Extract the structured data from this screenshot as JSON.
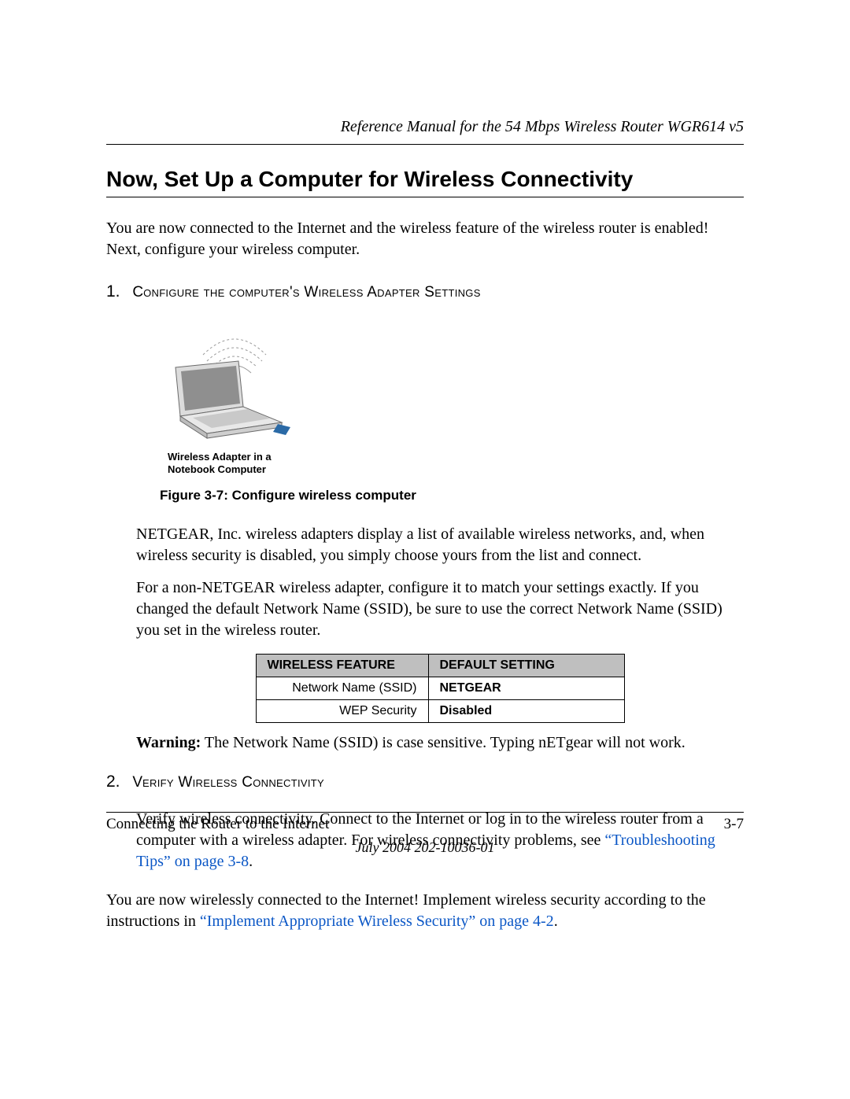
{
  "running_head": "Reference Manual for the 54 Mbps Wireless Router WGR614 v5",
  "section_title": "Now, Set Up a Computer for Wireless Connectivity",
  "intro": "You are now connected to the Internet and the wireless feature of the wireless router is enabled! Next, configure your wireless computer.",
  "step1": {
    "num": "1.",
    "pre": "C",
    "rest": "onfigure the computer's Wireless Adapter Settings"
  },
  "figure": {
    "caption_small_l1": "Wireless Adapter in a",
    "caption_small_l2": "Notebook Computer",
    "caption": "Figure 3-7:  Configure wireless computer"
  },
  "para1": "NETGEAR, Inc. wireless adapters display a list of available wireless networks, and, when wireless security is disabled, you simply choose yours from the list and connect.",
  "para2": "For a non-NETGEAR wireless adapter, configure it to match your settings exactly. If you changed the default Network Name (SSID), be sure to use the correct Network Name (SSID) you set in the wireless router.",
  "table": {
    "h1": "Wireless Feature",
    "h2": "Default Setting",
    "r1c1": "Network Name (SSID)",
    "r1c2": "NETGEAR",
    "r2c1": "WEP Security",
    "r2c2": "Disabled"
  },
  "warning_label": "Warning:",
  "warning_text": " The Network Name (SSID) is case sensitive. Typing nETgear will not work.",
  "step2": {
    "num": "2.",
    "pre": "V",
    "rest": "erify Wireless Connectivity"
  },
  "verify_pre": "Verify wireless connectivity. Connect to the Internet or log in to the wireless router from a computer with a wireless adapter. For wireless connectivity problems, see ",
  "verify_link": "“Troubleshooting Tips” on page 3-8",
  "verify_post": ".",
  "closing_pre": "You are now wirelessly connected to the Internet! Implement wireless security according to the instructions in ",
  "closing_link": "“Implement Appropriate Wireless Security” on page 4-2",
  "closing_post": ".",
  "footer": {
    "left": "Connecting the Router to the Internet",
    "right": "3-7",
    "date": "July 2004 202-10036-01"
  }
}
